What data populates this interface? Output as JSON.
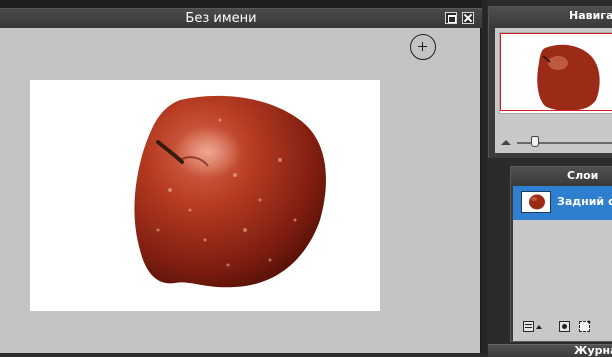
{
  "document": {
    "title": "Без имени"
  },
  "navigator": {
    "title": "Навигатор",
    "viewbox_color": "#d81e1e",
    "zoom_level_fraction": 0.14
  },
  "layers": {
    "title": "Слои",
    "items": [
      {
        "label": "Задний фон",
        "selected": true
      }
    ],
    "selected_color": "#2f7fd1"
  },
  "journal": {
    "title": "Журнал"
  },
  "icons": [
    "maximize-icon",
    "close-icon",
    "brush-cursor-icon",
    "zoom-out-icon",
    "blend-mode-icon",
    "layer-mask-icon",
    "new-layer-icon"
  ]
}
